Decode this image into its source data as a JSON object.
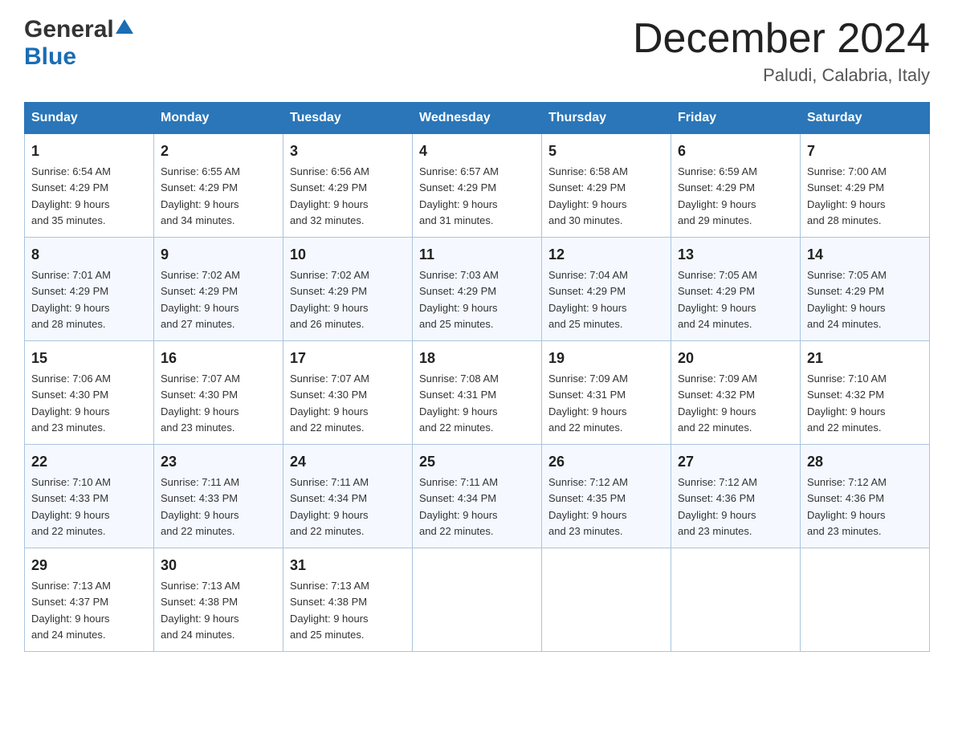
{
  "logo": {
    "general": "General",
    "blue": "Blue"
  },
  "title": "December 2024",
  "subtitle": "Paludi, Calabria, Italy",
  "days_of_week": [
    "Sunday",
    "Monday",
    "Tuesday",
    "Wednesday",
    "Thursday",
    "Friday",
    "Saturday"
  ],
  "weeks": [
    [
      {
        "day": "1",
        "sunrise": "6:54 AM",
        "sunset": "4:29 PM",
        "daylight": "9 hours and 35 minutes."
      },
      {
        "day": "2",
        "sunrise": "6:55 AM",
        "sunset": "4:29 PM",
        "daylight": "9 hours and 34 minutes."
      },
      {
        "day": "3",
        "sunrise": "6:56 AM",
        "sunset": "4:29 PM",
        "daylight": "9 hours and 32 minutes."
      },
      {
        "day": "4",
        "sunrise": "6:57 AM",
        "sunset": "4:29 PM",
        "daylight": "9 hours and 31 minutes."
      },
      {
        "day": "5",
        "sunrise": "6:58 AM",
        "sunset": "4:29 PM",
        "daylight": "9 hours and 30 minutes."
      },
      {
        "day": "6",
        "sunrise": "6:59 AM",
        "sunset": "4:29 PM",
        "daylight": "9 hours and 29 minutes."
      },
      {
        "day": "7",
        "sunrise": "7:00 AM",
        "sunset": "4:29 PM",
        "daylight": "9 hours and 28 minutes."
      }
    ],
    [
      {
        "day": "8",
        "sunrise": "7:01 AM",
        "sunset": "4:29 PM",
        "daylight": "9 hours and 28 minutes."
      },
      {
        "day": "9",
        "sunrise": "7:02 AM",
        "sunset": "4:29 PM",
        "daylight": "9 hours and 27 minutes."
      },
      {
        "day": "10",
        "sunrise": "7:02 AM",
        "sunset": "4:29 PM",
        "daylight": "9 hours and 26 minutes."
      },
      {
        "day": "11",
        "sunrise": "7:03 AM",
        "sunset": "4:29 PM",
        "daylight": "9 hours and 25 minutes."
      },
      {
        "day": "12",
        "sunrise": "7:04 AM",
        "sunset": "4:29 PM",
        "daylight": "9 hours and 25 minutes."
      },
      {
        "day": "13",
        "sunrise": "7:05 AM",
        "sunset": "4:29 PM",
        "daylight": "9 hours and 24 minutes."
      },
      {
        "day": "14",
        "sunrise": "7:05 AM",
        "sunset": "4:29 PM",
        "daylight": "9 hours and 24 minutes."
      }
    ],
    [
      {
        "day": "15",
        "sunrise": "7:06 AM",
        "sunset": "4:30 PM",
        "daylight": "9 hours and 23 minutes."
      },
      {
        "day": "16",
        "sunrise": "7:07 AM",
        "sunset": "4:30 PM",
        "daylight": "9 hours and 23 minutes."
      },
      {
        "day": "17",
        "sunrise": "7:07 AM",
        "sunset": "4:30 PM",
        "daylight": "9 hours and 22 minutes."
      },
      {
        "day": "18",
        "sunrise": "7:08 AM",
        "sunset": "4:31 PM",
        "daylight": "9 hours and 22 minutes."
      },
      {
        "day": "19",
        "sunrise": "7:09 AM",
        "sunset": "4:31 PM",
        "daylight": "9 hours and 22 minutes."
      },
      {
        "day": "20",
        "sunrise": "7:09 AM",
        "sunset": "4:32 PM",
        "daylight": "9 hours and 22 minutes."
      },
      {
        "day": "21",
        "sunrise": "7:10 AM",
        "sunset": "4:32 PM",
        "daylight": "9 hours and 22 minutes."
      }
    ],
    [
      {
        "day": "22",
        "sunrise": "7:10 AM",
        "sunset": "4:33 PM",
        "daylight": "9 hours and 22 minutes."
      },
      {
        "day": "23",
        "sunrise": "7:11 AM",
        "sunset": "4:33 PM",
        "daylight": "9 hours and 22 minutes."
      },
      {
        "day": "24",
        "sunrise": "7:11 AM",
        "sunset": "4:34 PM",
        "daylight": "9 hours and 22 minutes."
      },
      {
        "day": "25",
        "sunrise": "7:11 AM",
        "sunset": "4:34 PM",
        "daylight": "9 hours and 22 minutes."
      },
      {
        "day": "26",
        "sunrise": "7:12 AM",
        "sunset": "4:35 PM",
        "daylight": "9 hours and 23 minutes."
      },
      {
        "day": "27",
        "sunrise": "7:12 AM",
        "sunset": "4:36 PM",
        "daylight": "9 hours and 23 minutes."
      },
      {
        "day": "28",
        "sunrise": "7:12 AM",
        "sunset": "4:36 PM",
        "daylight": "9 hours and 23 minutes."
      }
    ],
    [
      {
        "day": "29",
        "sunrise": "7:13 AM",
        "sunset": "4:37 PM",
        "daylight": "9 hours and 24 minutes."
      },
      {
        "day": "30",
        "sunrise": "7:13 AM",
        "sunset": "4:38 PM",
        "daylight": "9 hours and 24 minutes."
      },
      {
        "day": "31",
        "sunrise": "7:13 AM",
        "sunset": "4:38 PM",
        "daylight": "9 hours and 25 minutes."
      },
      null,
      null,
      null,
      null
    ]
  ],
  "labels": {
    "sunrise": "Sunrise:",
    "sunset": "Sunset:",
    "daylight": "Daylight:"
  }
}
